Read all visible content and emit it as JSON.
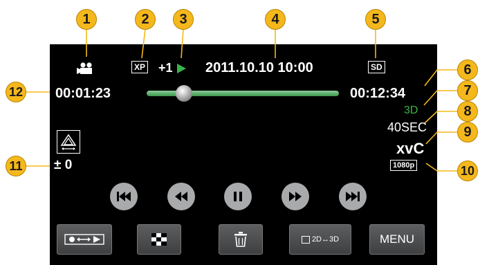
{
  "callouts": [
    "1",
    "2",
    "3",
    "4",
    "5",
    "6",
    "7",
    "8",
    "9",
    "10",
    "11",
    "12"
  ],
  "status": {
    "camera_icon": "movie-camera-icon",
    "quality": "XP",
    "speed": "+1",
    "play_icon": "play-arrow-icon",
    "datetime": "2011.10.10 10:00",
    "media": "SD"
  },
  "timeline": {
    "elapsed": "00:01:23",
    "total": "00:12:34",
    "progress": 0.1
  },
  "info": {
    "mode_3d": "3D",
    "interval": "40SEC",
    "xvc": "xvC",
    "resolution": "1080p"
  },
  "parallax": {
    "icon": "parallax-adjust-icon",
    "value": "± 0"
  },
  "transport": [
    "skip-back-icon",
    "rewind-icon",
    "pause-icon",
    "fast-forward-icon",
    "skip-forward-icon"
  ],
  "buttons": {
    "record_play_icon": "record-play-toggle-icon",
    "index_icon": "index-grid-icon",
    "delete_icon": "trash-icon",
    "toggle_3d": "2D↔3D",
    "menu": "MENU"
  },
  "colors": {
    "accent": "#f5b81c",
    "green": "#3cb34a",
    "screen": "#000000"
  }
}
